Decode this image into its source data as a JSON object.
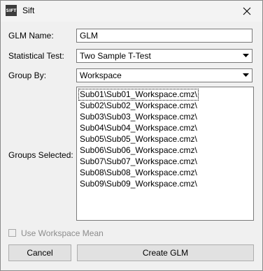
{
  "window": {
    "title": "Sift",
    "icon": "sift-app-icon",
    "icon_text": "SIFT",
    "close": "close-icon"
  },
  "form": {
    "glm_name_label": "GLM Name:",
    "glm_name_value": "GLM",
    "test_label": "Statistical Test:",
    "test_value": "Two Sample T-Test",
    "group_by_label": "Group By:",
    "group_by_value": "Workspace",
    "groups_label": "Groups Selected:",
    "groups": [
      "Sub01\\Sub01_Workspace.cmz\\",
      "Sub02\\Sub02_Workspace.cmz\\",
      "Sub03\\Sub03_Workspace.cmz\\",
      "Sub04\\Sub04_Workspace.cmz\\",
      "Sub05\\Sub05_Workspace.cmz\\",
      "Sub06\\Sub06_Workspace.cmz\\",
      "Sub07\\Sub07_Workspace.cmz\\",
      "Sub08\\Sub08_Workspace.cmz\\",
      "Sub09\\Sub09_Workspace.cmz\\"
    ],
    "use_workspace_mean_label": "Use Workspace Mean",
    "use_workspace_mean_checked": false
  },
  "buttons": {
    "cancel": "Cancel",
    "create": "Create GLM"
  }
}
